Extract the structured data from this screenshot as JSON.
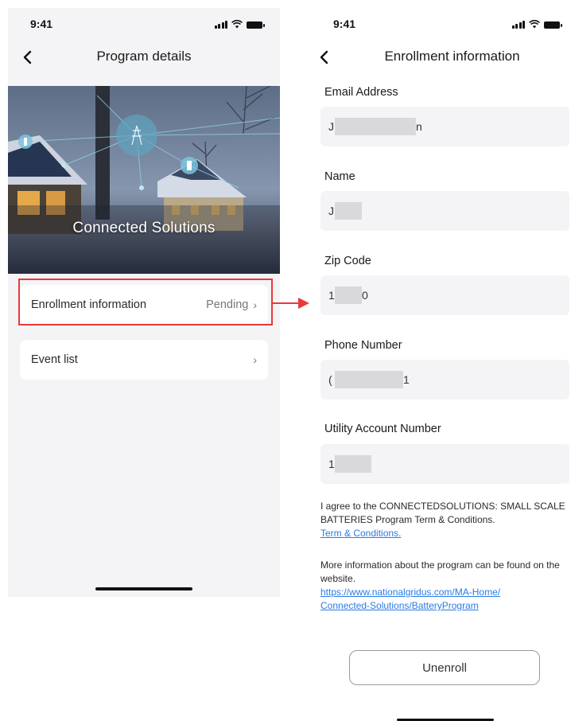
{
  "left_screen": {
    "status": {
      "time": "9:41"
    },
    "nav": {
      "title": "Program details"
    },
    "hero": {
      "title": "Connected Solutions"
    },
    "items": [
      {
        "label": "Enrollment information",
        "status": "Pending"
      },
      {
        "label": "Event list",
        "status": ""
      }
    ]
  },
  "right_screen": {
    "status": {
      "time": "9:41"
    },
    "nav": {
      "title": "Enrollment information"
    },
    "fields": [
      {
        "label": "Email Address",
        "value_start": "J",
        "value_end": "n"
      },
      {
        "label": "Name",
        "value_start": "J",
        "value_end": ""
      },
      {
        "label": "Zip Code",
        "value_start": "1",
        "value_end": "0"
      },
      {
        "label": "Phone Number",
        "value_start": "(",
        "value_end": "1"
      },
      {
        "label": "Utility Account Number",
        "value_start": "1",
        "value_end": ""
      }
    ],
    "terms_text": "I agree to the CONNECTEDSOLUTIONS: SMALL SCALE BATTERIES Program Term & Conditions.",
    "terms_link": "Term & Conditions.",
    "more_info_text": "More information about the program can be found on the website.",
    "more_info_link_line1": "https://www.nationalgridus.com/MA-Home/",
    "more_info_link_line2": "Connected-Solutions/BatteryProgram",
    "unenroll_label": "Unenroll"
  },
  "colors": {
    "highlight": "#e8393b",
    "link": "#2b7be4",
    "screen_bg": "#f4f4f6"
  },
  "icons": [
    "back-icon",
    "chevron-right-icon",
    "signal-icon",
    "wifi-icon",
    "battery-icon",
    "power-tower-icon",
    "battery-device-icon",
    "arrow-right-icon"
  ]
}
